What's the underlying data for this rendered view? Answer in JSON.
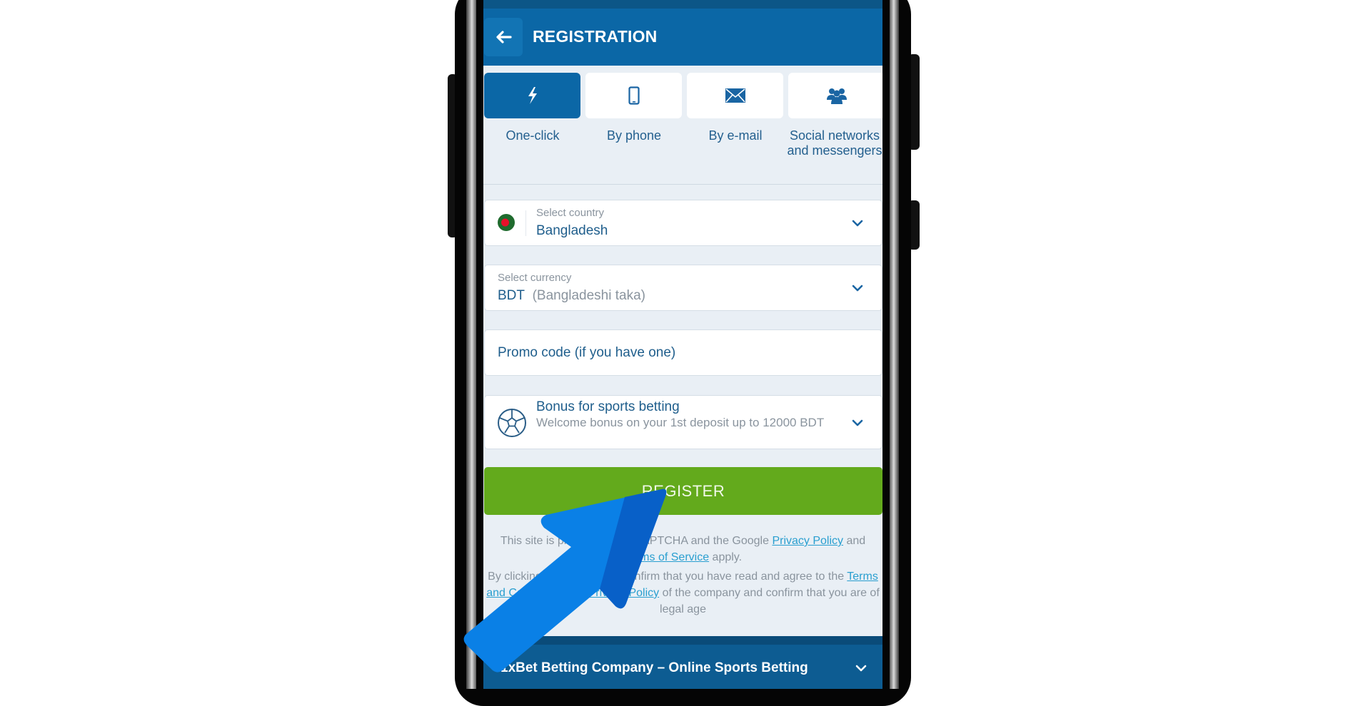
{
  "header": {
    "title": "REGISTRATION",
    "back_icon": "arrow-left-icon"
  },
  "tabs": [
    {
      "label": "One-click",
      "icon": "lightning-icon",
      "active": true
    },
    {
      "label": "By phone",
      "icon": "phone-icon",
      "active": false
    },
    {
      "label": "By e-mail",
      "icon": "envelope-icon",
      "active": false
    },
    {
      "label": "Social networks and messengers",
      "icon": "users-icon",
      "active": false
    }
  ],
  "country": {
    "label": "Select country",
    "value": "Bangladesh",
    "flag_icon": "bangladesh-flag-icon"
  },
  "currency": {
    "label": "Select currency",
    "code": "BDT",
    "name": "(Bangladeshi taka)"
  },
  "promo": {
    "placeholder": "Promo code (if you have one)"
  },
  "bonus": {
    "title": "Bonus for sports betting",
    "description": "Welcome bonus on your 1st deposit up to 12000 BDT",
    "icon": "soccer-ball-icon"
  },
  "register_button": "REGISTER",
  "legal": {
    "line1_pre": "This site is protected by reCAPTCHA and the Google ",
    "privacy_link_1": "Privacy Policy",
    "line1_mid": " and ",
    "terms_service_link": "Terms of Service",
    "line1_post": " apply.",
    "line2_pre": "By clicking this button you confirm that you have read and agree to the ",
    "terms_conditions_link": "Terms and Conditions",
    "line2_mid": " and ",
    "privacy_link_2": "Privacy Policy",
    "line2_post": " of the company and confirm that you are of legal age"
  },
  "footer": {
    "title": "1xBet Betting Company – Online Sports Betting"
  },
  "colors": {
    "header": "#0b67a6",
    "register": "#63aa1c",
    "link": "#2a9fd0",
    "annotation_arrow": "#0a7be0"
  }
}
